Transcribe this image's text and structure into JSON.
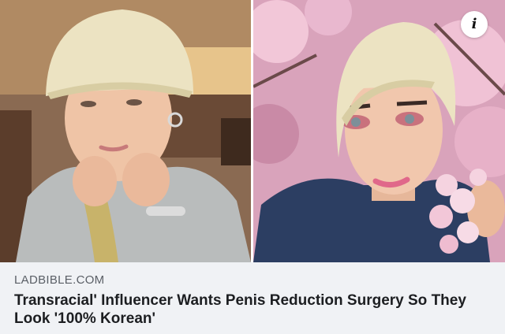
{
  "link_preview": {
    "source": "LADBIBLE.COM",
    "headline": "Transracial' Influencer Wants Penis Reduction Surgery So They Look '100% Korean'",
    "info_icon": {
      "name": "info-icon",
      "glyph": "i"
    }
  },
  "colors": {
    "caption_background": "#f0f2f5",
    "source_text": "#5a5f66",
    "headline_text": "#1c1e21",
    "hair": "#ece3c2",
    "blossom": "#e9b8cf",
    "sweater_left": "#b9bcbc",
    "sweater_right": "#2c3e62"
  }
}
